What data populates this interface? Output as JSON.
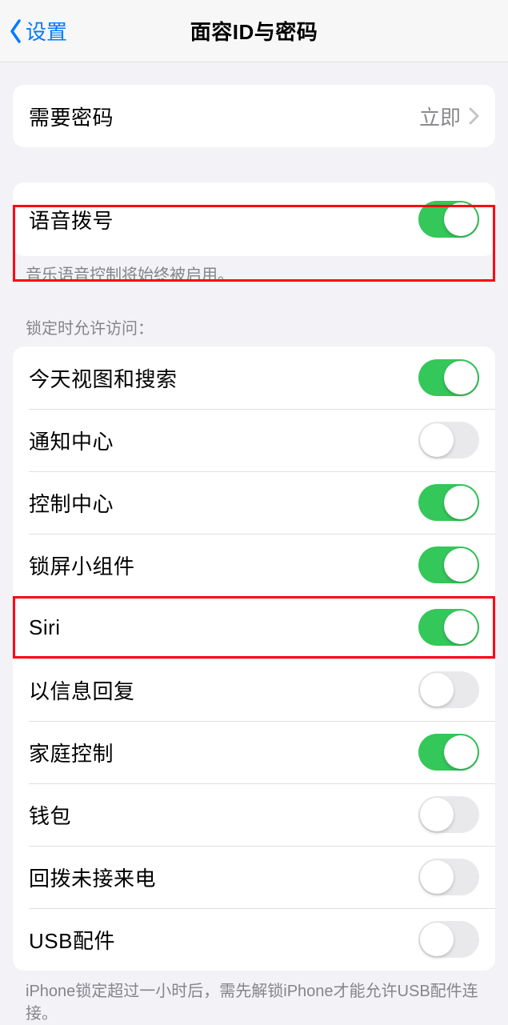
{
  "nav": {
    "back_label": "设置",
    "title": "面容ID与密码"
  },
  "require_passcode": {
    "label": "需要密码",
    "value": "立即"
  },
  "voice_dial": {
    "label": "语音拨号",
    "footer": "音乐语音控制将始终被启用。",
    "on": true
  },
  "lock_header": "锁定时允许访问：",
  "lock_items": [
    {
      "label": "今天视图和搜索",
      "on": true
    },
    {
      "label": "通知中心",
      "on": false
    },
    {
      "label": "控制中心",
      "on": true
    },
    {
      "label": "锁屏小组件",
      "on": true
    },
    {
      "label": "Siri",
      "on": true
    },
    {
      "label": "以信息回复",
      "on": false
    },
    {
      "label": "家庭控制",
      "on": true
    },
    {
      "label": "钱包",
      "on": false
    },
    {
      "label": "回拨未接来电",
      "on": false
    },
    {
      "label": "USB配件",
      "on": false
    }
  ],
  "usb_footer": "iPhone锁定超过一小时后，需先解锁iPhone才能允许USB配件连接。"
}
